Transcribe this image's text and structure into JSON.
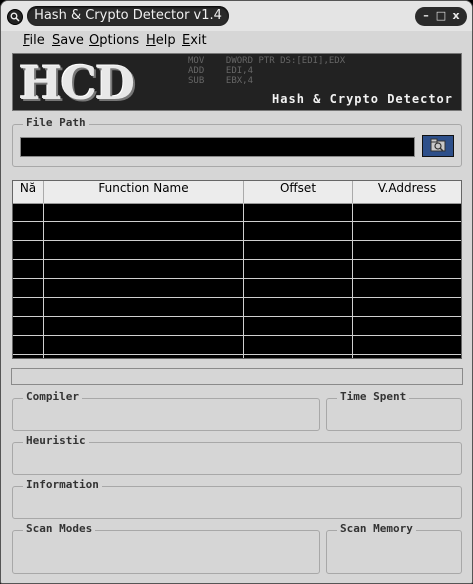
{
  "window": {
    "title": "Hash & Crypto Detector v1.4",
    "controls": {
      "minimize": "–",
      "maximize": "□",
      "close": "x"
    }
  },
  "menu": {
    "items": [
      {
        "label": "File",
        "mnemonic": "F",
        "rest": "ile"
      },
      {
        "label": "Save",
        "mnemonic": "S",
        "rest": "ave"
      },
      {
        "label": "Options",
        "mnemonic": "O",
        "rest": "ptions"
      },
      {
        "label": "Help",
        "mnemonic": "H",
        "rest": "elp"
      },
      {
        "label": "Exit",
        "mnemonic": "E",
        "rest": "xit"
      }
    ]
  },
  "banner": {
    "logo": "HCD",
    "subtitle": "Hash & Crypto Detector",
    "asm_text": "MOV    DWORD PTR DS:[EDI],EDX\nADD    EDI,4\nSUB    EBX,4"
  },
  "file_path": {
    "label": "File Path",
    "value": ""
  },
  "results_table": {
    "columns": [
      "Nă",
      "Function Name",
      "Offset",
      "V.Address"
    ],
    "rows": [
      [
        "",
        "",
        "",
        ""
      ],
      [
        "",
        "",
        "",
        ""
      ],
      [
        "",
        "",
        "",
        ""
      ],
      [
        "",
        "",
        "",
        ""
      ],
      [
        "",
        "",
        "",
        ""
      ],
      [
        "",
        "",
        "",
        ""
      ],
      [
        "",
        "",
        "",
        ""
      ],
      [
        "",
        "",
        "",
        ""
      ]
    ]
  },
  "panels": {
    "compiler": "Compiler",
    "time_spent": "Time Spent",
    "heuristic": "Heuristic",
    "information": "Information",
    "scan_modes": "Scan Modes",
    "scan_memory": "Scan Memory"
  },
  "colors": {
    "window_bg": "#d6d6d6",
    "title_pill": "#2a2a2a",
    "list_bg": "#000000",
    "browse_button": "#2d4f8a"
  },
  "icons": {
    "app": "magnifier-icon",
    "browse": "folder-browse-icon"
  }
}
